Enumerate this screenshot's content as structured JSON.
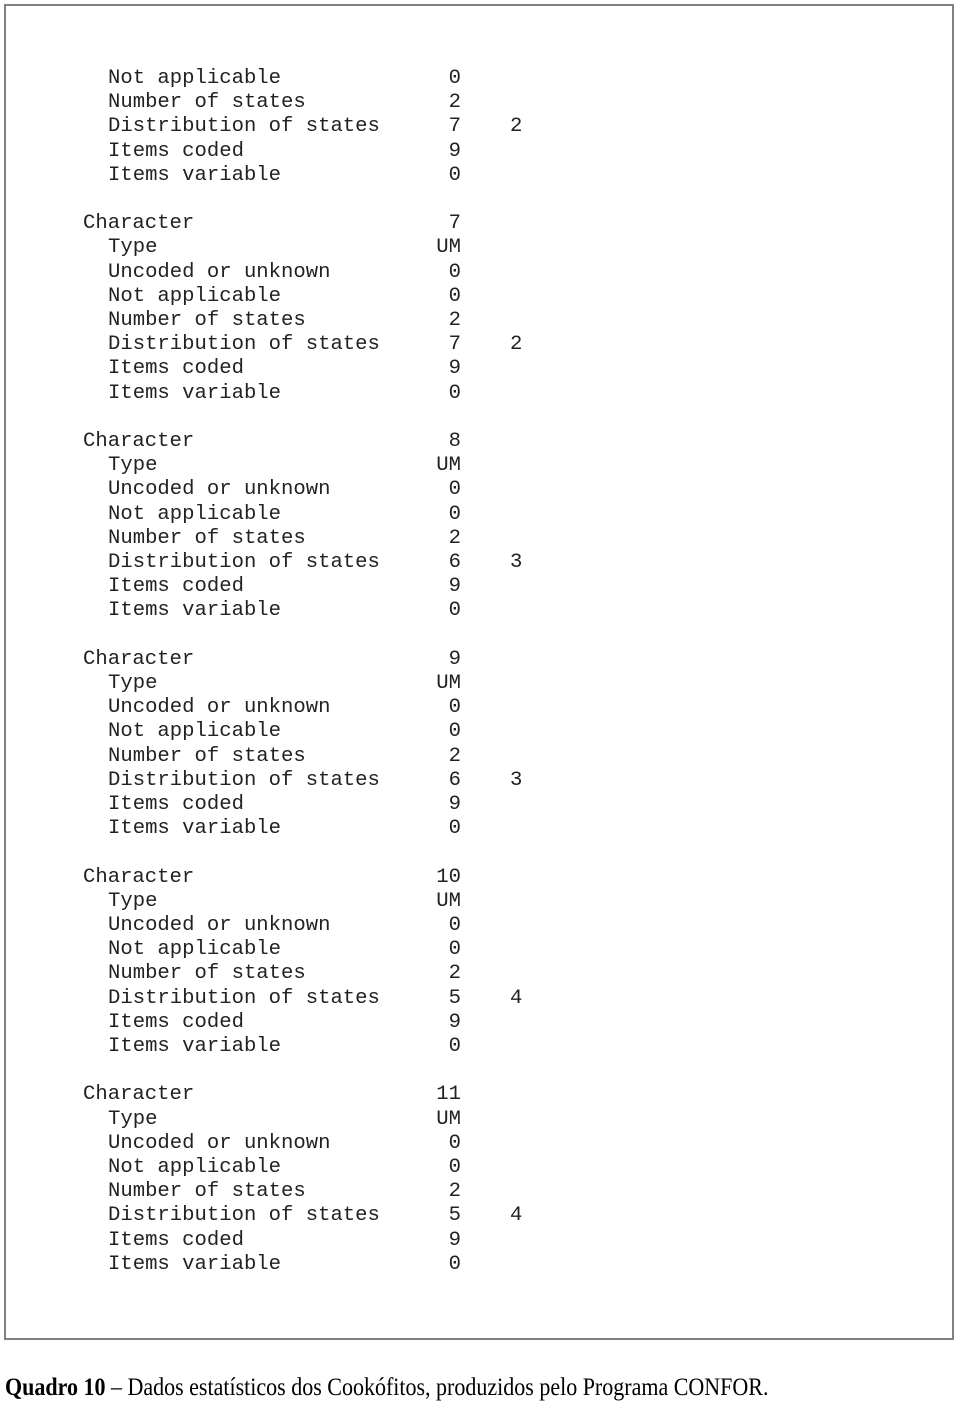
{
  "blocks": [
    {
      "header": null,
      "rows": [
        {
          "label": "Not applicable",
          "value": "0"
        },
        {
          "label": "Number of states",
          "value": "2"
        },
        {
          "label": "Distribution of states",
          "value": "7",
          "value2": "2"
        },
        {
          "label": "Items coded",
          "value": "9"
        },
        {
          "label": "Items variable",
          "value": "0"
        }
      ]
    },
    {
      "header": {
        "label": "Character",
        "value": "7"
      },
      "rows": [
        {
          "label": "Type",
          "value": "UM"
        },
        {
          "label": "Uncoded or unknown",
          "value": "0"
        },
        {
          "label": "Not applicable",
          "value": "0"
        },
        {
          "label": "Number of states",
          "value": "2"
        },
        {
          "label": "Distribution of states",
          "value": "7",
          "value2": "2"
        },
        {
          "label": "Items coded",
          "value": "9"
        },
        {
          "label": "Items variable",
          "value": "0"
        }
      ]
    },
    {
      "header": {
        "label": "Character",
        "value": "8"
      },
      "rows": [
        {
          "label": "Type",
          "value": "UM"
        },
        {
          "label": "Uncoded or unknown",
          "value": "0"
        },
        {
          "label": "Not applicable",
          "value": "0"
        },
        {
          "label": "Number of states",
          "value": "2"
        },
        {
          "label": "Distribution of states",
          "value": "6",
          "value2": "3"
        },
        {
          "label": "Items coded",
          "value": "9"
        },
        {
          "label": "Items variable",
          "value": "0"
        }
      ]
    },
    {
      "header": {
        "label": "Character",
        "value": "9"
      },
      "rows": [
        {
          "label": "Type",
          "value": "UM"
        },
        {
          "label": "Uncoded or unknown",
          "value": "0"
        },
        {
          "label": "Not applicable",
          "value": "0"
        },
        {
          "label": "Number of states",
          "value": "2"
        },
        {
          "label": "Distribution of states",
          "value": "6",
          "value2": "3"
        },
        {
          "label": "Items coded",
          "value": "9"
        },
        {
          "label": "Items variable",
          "value": "0"
        }
      ]
    },
    {
      "header": {
        "label": "Character",
        "value": "10"
      },
      "rows": [
        {
          "label": "Type",
          "value": "UM"
        },
        {
          "label": "Uncoded or unknown",
          "value": "0"
        },
        {
          "label": "Not applicable",
          "value": "0"
        },
        {
          "label": "Number of states",
          "value": "2"
        },
        {
          "label": "Distribution of states",
          "value": "5",
          "value2": "4"
        },
        {
          "label": "Items coded",
          "value": "9"
        },
        {
          "label": "Items variable",
          "value": "0"
        }
      ]
    },
    {
      "header": {
        "label": "Character",
        "value": "11"
      },
      "rows": [
        {
          "label": "Type",
          "value": "UM"
        },
        {
          "label": "Uncoded or unknown",
          "value": "0"
        },
        {
          "label": "Not applicable",
          "value": "0"
        },
        {
          "label": "Number of states",
          "value": "2"
        },
        {
          "label": "Distribution of states",
          "value": "5",
          "value2": "4"
        },
        {
          "label": "Items coded",
          "value": "9"
        },
        {
          "label": "Items variable",
          "value": "0"
        }
      ]
    }
  ],
  "caption": {
    "bold": "Quadro 10",
    "text": " – Dados estatísticos dos Cookófitos, produzidos pelo Programa CONFOR."
  }
}
